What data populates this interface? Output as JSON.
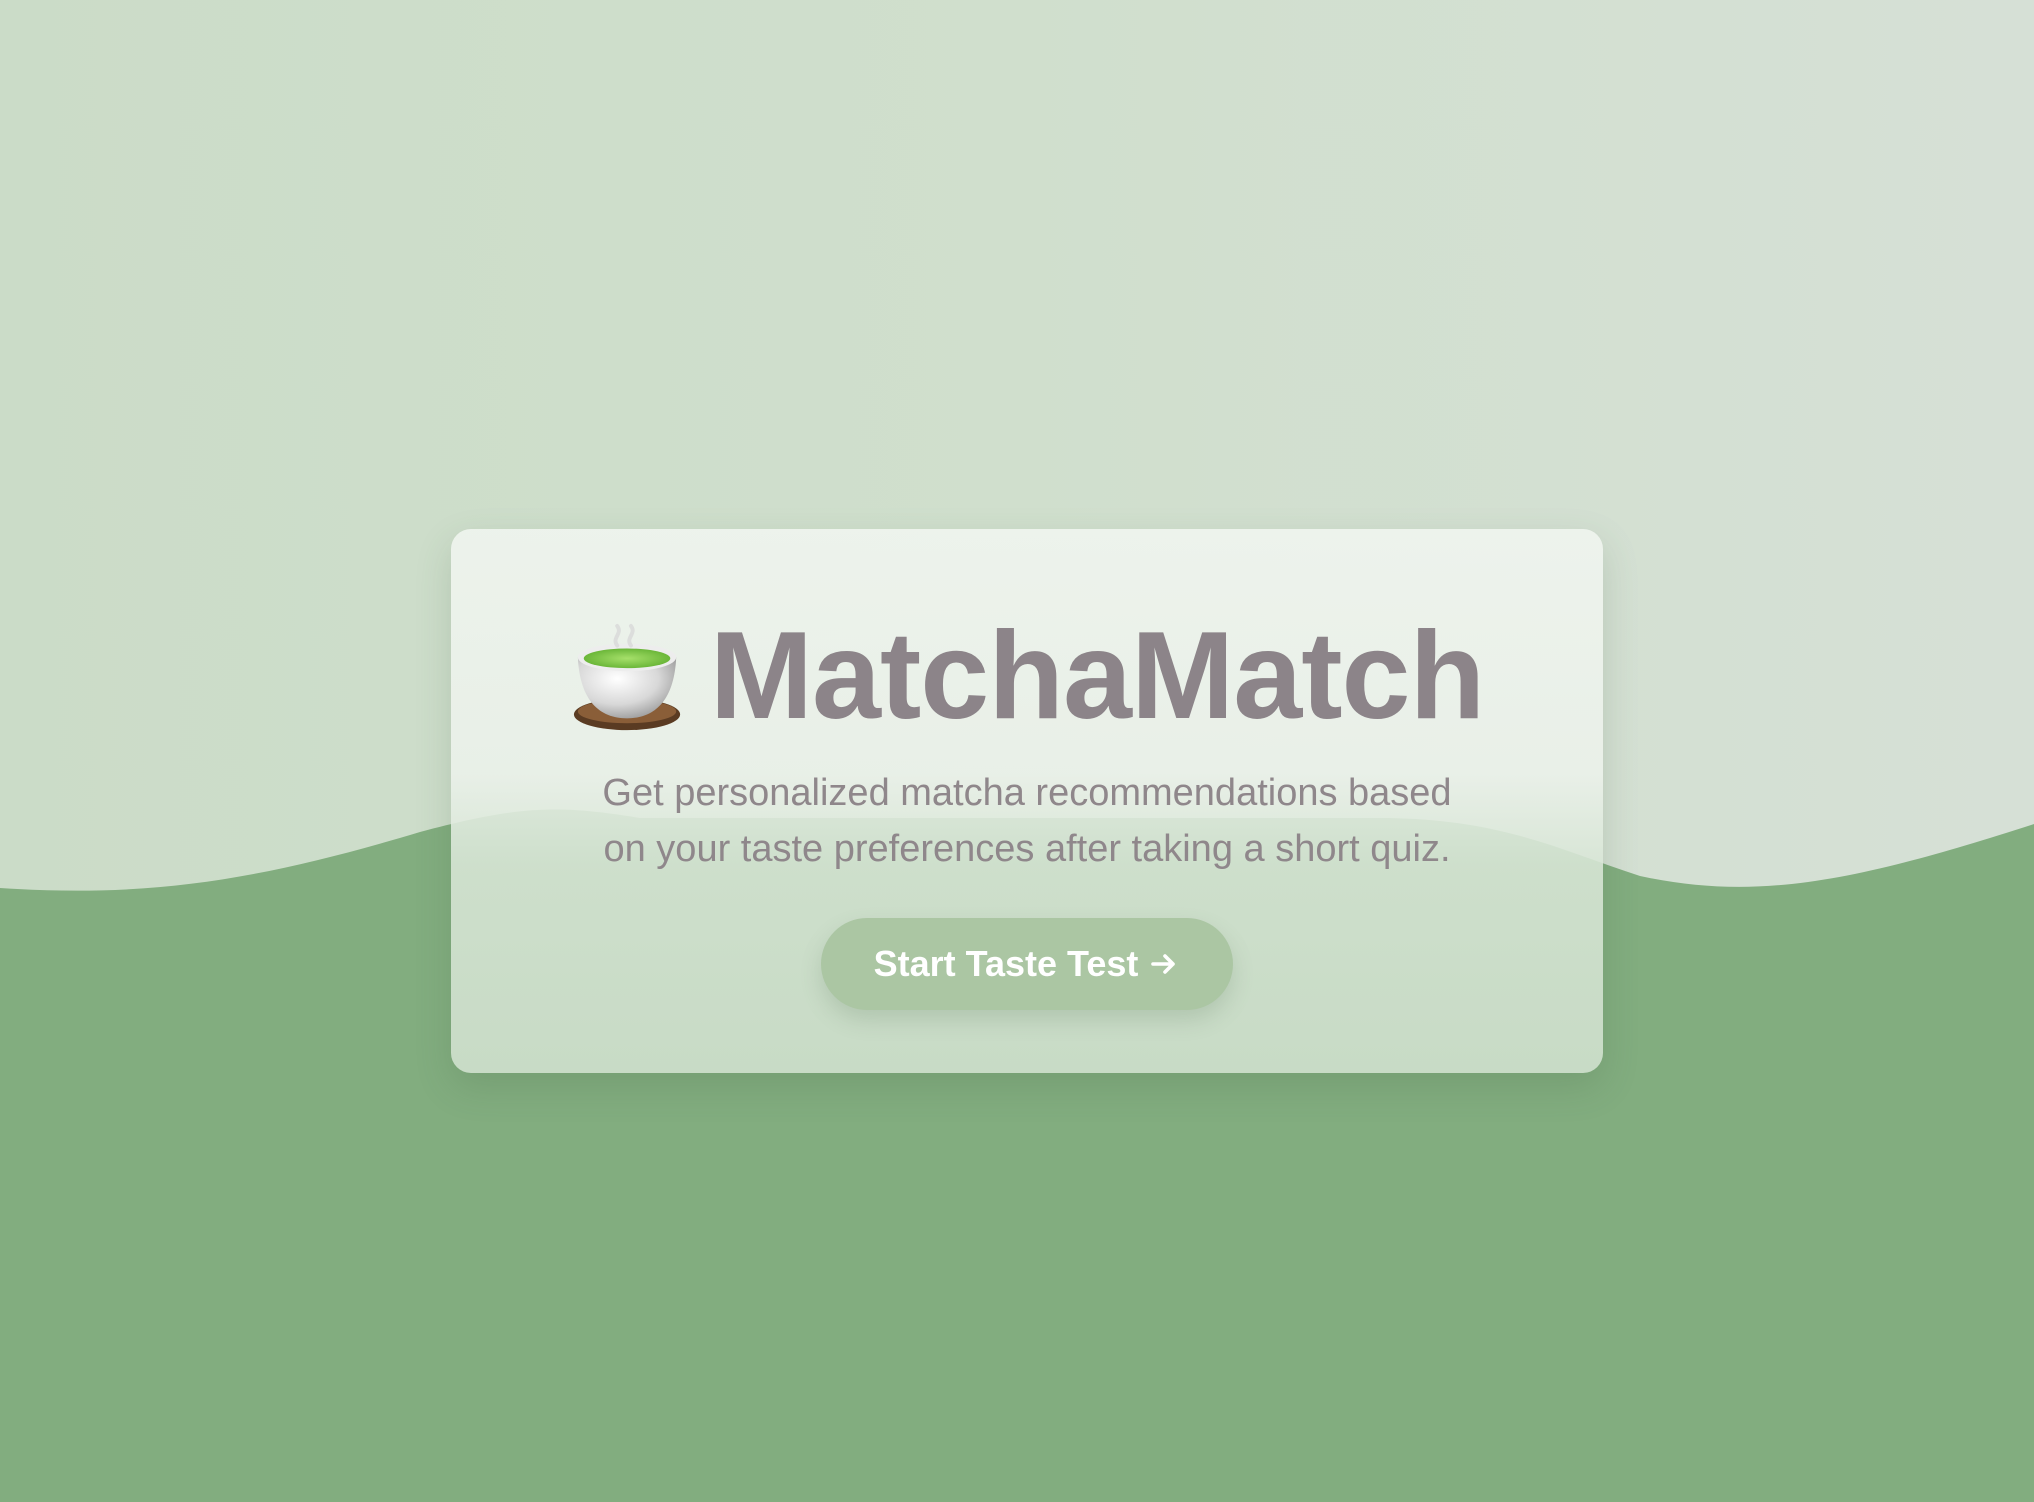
{
  "app": {
    "title": "MatchaMatch",
    "tagline": "Get personalized matcha recommendations based on your taste preferences after taking a short quiz."
  },
  "hero": {
    "logo_icon": "teacup-icon",
    "cta_label": "Start Taste Test",
    "cta_icon": "arrow-right-icon"
  },
  "colors": {
    "sky": "#cfdecc",
    "hill": "#82ad7f",
    "title_text": "#8c8489",
    "cta_background": "#abc6a3",
    "cta_text": "#ffffff"
  }
}
